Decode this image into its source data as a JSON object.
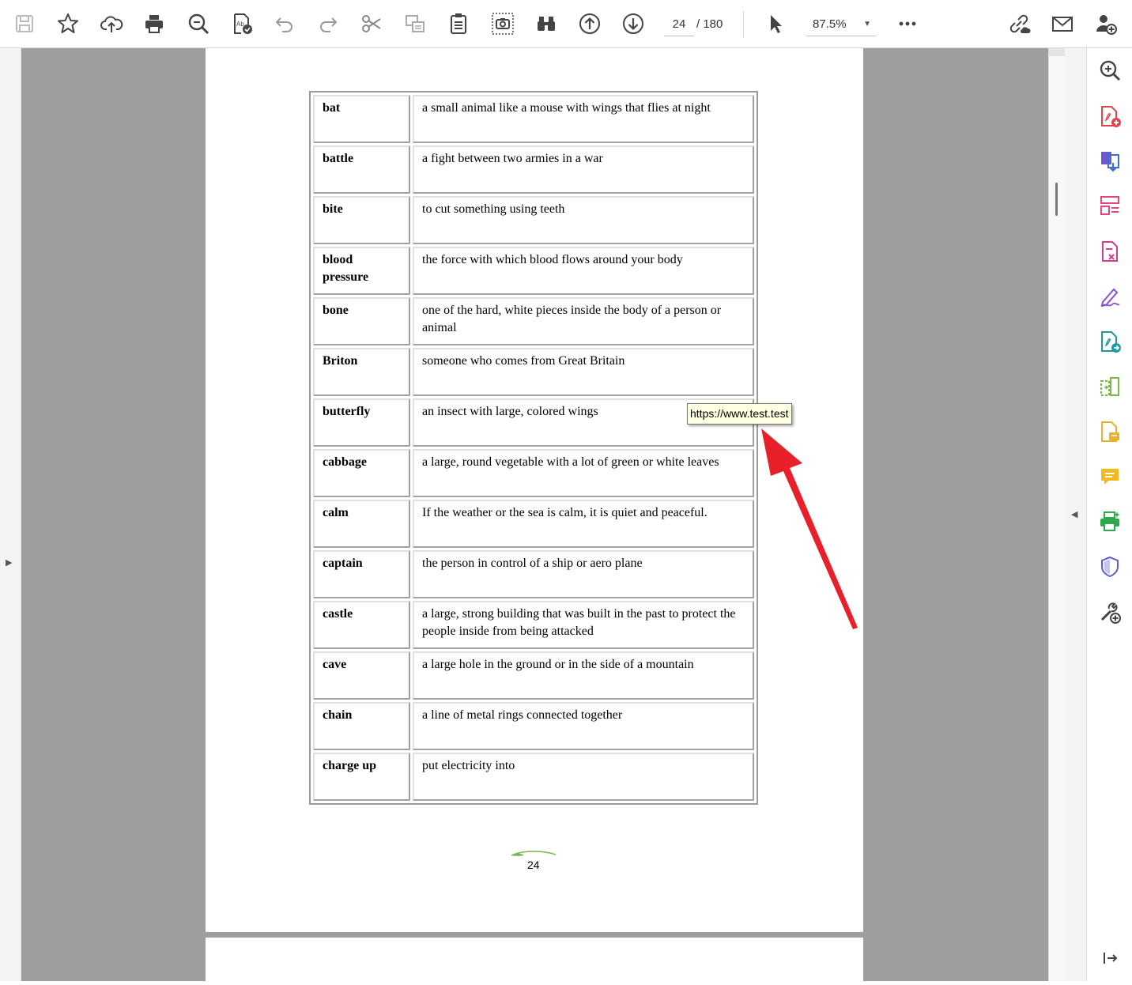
{
  "toolbar": {
    "page_current": "24",
    "page_total": "/ 180",
    "zoom": "87.5%",
    "icons": [
      "save-icon",
      "bookmark-star-icon",
      "upload-cloud-icon",
      "print-icon",
      "zoom-search-icon",
      "spell-check-icon",
      "undo-icon",
      "redo-icon",
      "cut-icon",
      "copy-format-icon",
      "paste-icon",
      "snapshot-icon",
      "binoculars-icon",
      "previous-page-icon",
      "next-page-icon",
      "select-cursor-icon",
      "more-icon",
      "share-link-icon",
      "email-icon",
      "add-user-icon"
    ]
  },
  "glossary": [
    {
      "term": "bat",
      "definition": "a small animal like a mouse with wings that flies at night"
    },
    {
      "term": "battle",
      "definition": "a fight between two armies in a war"
    },
    {
      "term": "bite",
      "definition": "to cut something using teeth"
    },
    {
      "term": "blood pressure",
      "definition": "the force with which blood flows around your body"
    },
    {
      "term": "bone",
      "definition": "one of the hard, white pieces inside the body of a person or animal"
    },
    {
      "term": "Briton",
      "definition": "someone who comes from Great Britain"
    },
    {
      "term": "butterfly",
      "definition": "an insect with large, colored wings"
    },
    {
      "term": "cabbage",
      "definition": "a large, round vegetable with a lot of green or white leaves"
    },
    {
      "term": "calm",
      "definition": "If the weather or the sea is calm, it is quiet and peaceful."
    },
    {
      "term": "captain",
      "definition": "the person in control of a ship or aero plane"
    },
    {
      "term": "castle",
      "definition": "a large, strong building that was built in the past to protect the people inside from being attacked"
    },
    {
      "term": "cave",
      "definition": "a large hole in the ground or in the side of a mountain"
    },
    {
      "term": "chain",
      "definition": "a line of metal rings connected together"
    },
    {
      "term": "charge up",
      "definition": "put electricity into"
    }
  ],
  "page_footer": {
    "number": "24"
  },
  "tooltip": {
    "text": "https://www.test.test"
  },
  "annotation": {
    "arrow_color": "#e8202a"
  },
  "right_panel": {
    "icons": [
      "zoom-search-icon",
      "create-pdf-icon",
      "export-pdf-icon",
      "organize-pages-icon",
      "edit-pdf-icon",
      "fill-sign-icon",
      "send-pdf-icon",
      "compare-icon",
      "comment-file-icon",
      "comment-icon",
      "print-production-icon",
      "protect-shield-icon",
      "tools-add-icon",
      "expand-panel-icon"
    ]
  },
  "colors": {
    "document_bg": "#9e9e9e",
    "accent_red": "#e8202a"
  }
}
